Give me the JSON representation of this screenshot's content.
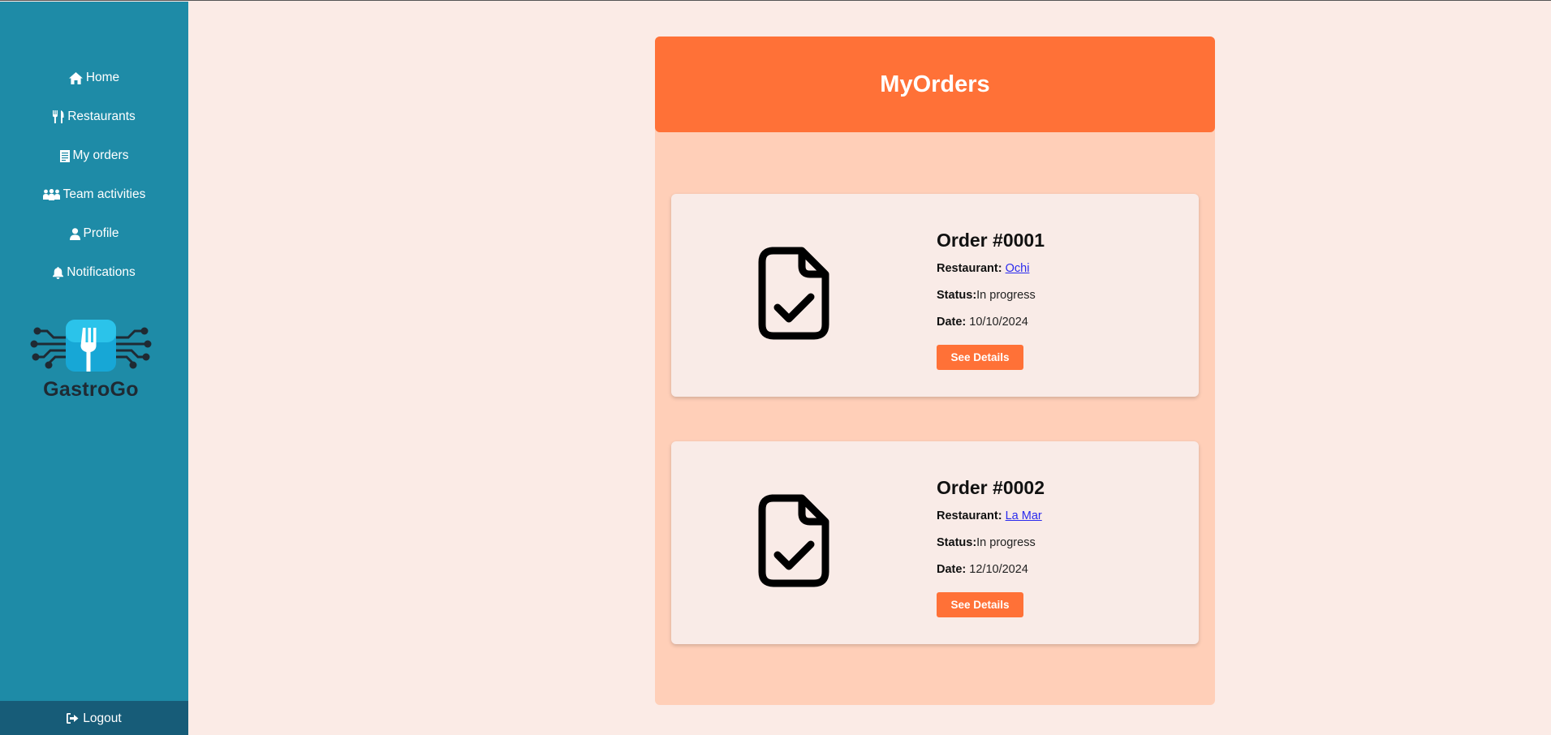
{
  "sidebar": {
    "items": [
      {
        "label": "Home",
        "icon": "home-icon"
      },
      {
        "label": "Restaurants",
        "icon": "utensils-icon"
      },
      {
        "label": "My orders",
        "icon": "receipt-icon"
      },
      {
        "label": "Team activities",
        "icon": "people-group-icon"
      },
      {
        "label": "Profile",
        "icon": "user-icon"
      },
      {
        "label": "Notifications",
        "icon": "bell-icon"
      }
    ],
    "logo_text": "GastroGo",
    "logout_label": "Logout"
  },
  "main": {
    "title": "MyOrders",
    "orders": [
      {
        "title": "Order #0001",
        "restaurant_label": "Restaurant:",
        "restaurant": "Ochi",
        "status_label": "Status:",
        "status": "In progress",
        "date_label": "Date:",
        "date": "10/10/2024",
        "button": "See Details"
      },
      {
        "title": "Order #0002",
        "restaurant_label": "Restaurant:",
        "restaurant": "La Mar",
        "status_label": "Status:",
        "status": "In progress",
        "date_label": "Date:",
        "date": "12/10/2024",
        "button": "See Details"
      }
    ]
  },
  "colors": {
    "sidebar": "#1e8ba7",
    "sidebar_logout": "#175c78",
    "accent": "#ff7137",
    "panel": "#ffcfb8",
    "background": "#fbebe6",
    "card": "#f9ebe7"
  }
}
